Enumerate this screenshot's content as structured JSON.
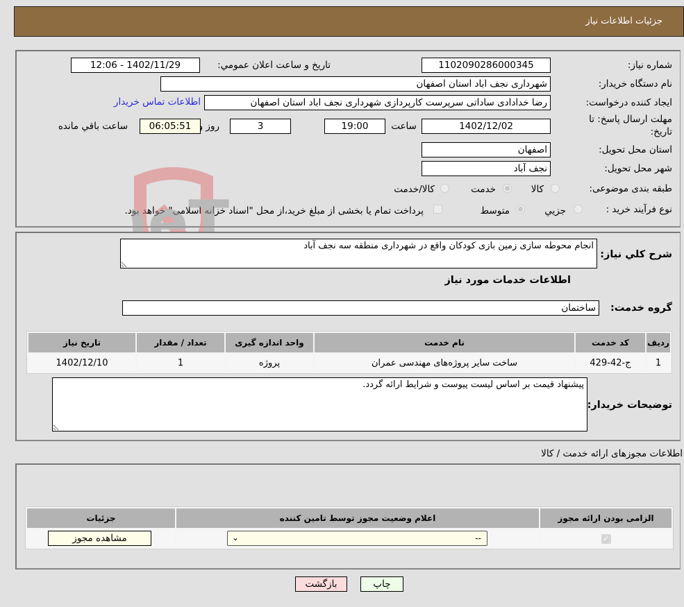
{
  "title": "جزئيات اطلاعات نياز",
  "info": {
    "need_number_label": "شماره نياز:",
    "need_number": "1102090286000345",
    "announce_label": "تاريخ و ساعت اعلان عمومي:",
    "announce_value": "1402/11/29 - 12:06",
    "buyer_org_label": "نام دستگاه خريدار:",
    "buyer_org": "شهرداری نجف اباد استان اصفهان",
    "creator_label": "ايجاد کننده درخواست:",
    "creator": "رضا خدادادی ساداتی سرپرست  کارپردازی شهرداری نجف اباد استان اصفهان",
    "contact_link": "اطلاعات تماس خريدار",
    "deadline_label_1": "مهلت ارسال پاسخ: تا",
    "deadline_label_2": "تاريخ:",
    "deadline_date": "1402/12/02",
    "time_label": "ساعت",
    "deadline_time": "19:00",
    "days": "3",
    "days_label": "روز و",
    "remaining": "06:05:51",
    "remaining_label": "ساعت باقي مانده",
    "province_label": "استان محل تحويل:",
    "province": "اصفهان",
    "city_label": "شهر محل تحويل:",
    "city": "نجف آباد",
    "category_label": "طبقه بندی موضوعی:",
    "category_options": [
      {
        "label": "کالا",
        "selected": false
      },
      {
        "label": "خدمت",
        "selected": true
      },
      {
        "label": "کالا/خدمت",
        "selected": false
      }
    ],
    "process_label": "نوع فرآيند خريد :",
    "process_options": [
      {
        "label": "جزيي",
        "selected": false
      },
      {
        "label": "متوسط",
        "selected": true
      }
    ],
    "treasury_note": "پرداخت تمام يا بخشی از مبلغ خريد،از محل \"اسناد خزانه اسلامی\" خواهد بود."
  },
  "description": {
    "label": "شرح کلي نياز:",
    "value": "انجام محوطه سازی زمین بازی کودکان واقع در شهرداری منطقه سه نجف آباد",
    "services_heading": "اطلاعات خدمات مورد نياز",
    "service_group_label": "گروه خدمت:",
    "service_group": "ساختمان"
  },
  "services_table": {
    "headers": [
      "رديف",
      "کد خدمت",
      "نام خدمت",
      "واحد اندازه گيری",
      "تعداد / مقدار",
      "تاريخ نياز"
    ],
    "rows": [
      [
        "1",
        "ج-42-429",
        "ساخت سایر پروژه‌های مهندسی عمران",
        "پروژه",
        "1",
        "1402/12/10"
      ]
    ]
  },
  "buyer_notes": {
    "label": "توضيحات خريدار:",
    "value": "پیشنهاد قیمت بر اساس لیست پیوست و شرایط ارائه گردد."
  },
  "permits": {
    "heading": "اطلاعات مجوزهای ارائه خدمت / کالا",
    "headers": [
      "الزامی بودن ارائه مجوز",
      "اعلام وضعيت مجوز توسط تامين کننده",
      "جزئيات"
    ],
    "row": {
      "required": true,
      "status": "--",
      "details_button": "مشاهده مجوز"
    }
  },
  "buttons": {
    "print": "چاپ",
    "back": "بازگشت"
  },
  "watermark": "AriaTender.neT"
}
